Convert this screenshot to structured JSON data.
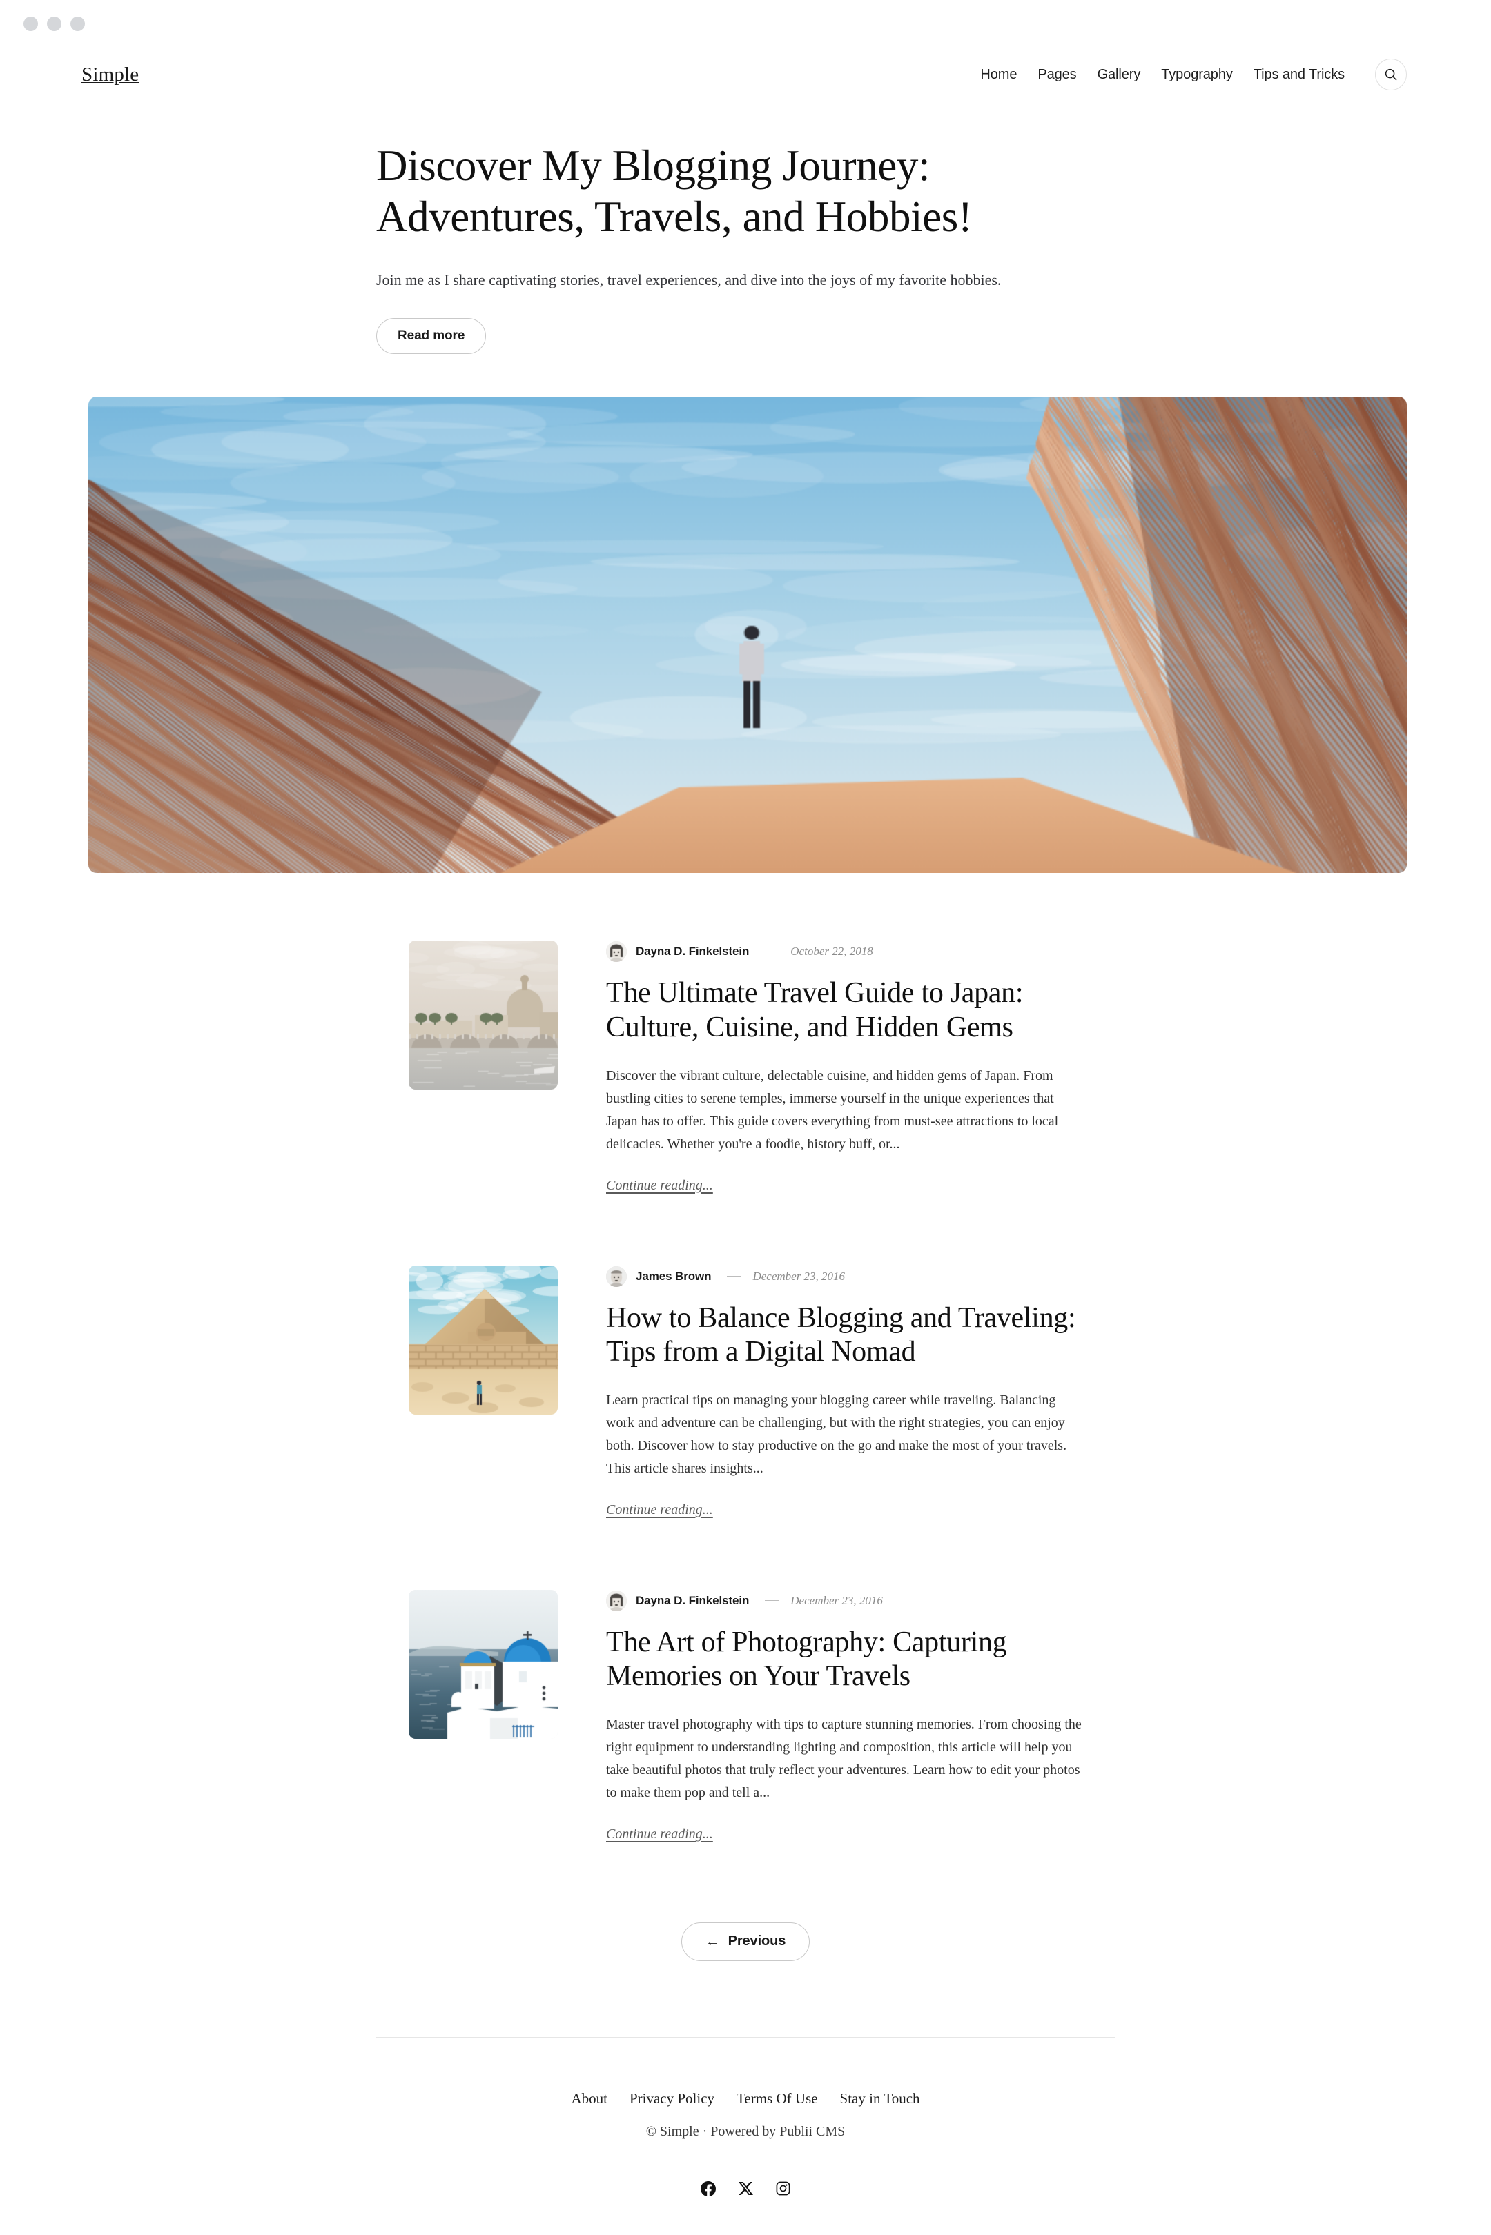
{
  "window": {
    "dots": [
      "window-dot-1",
      "window-dot-2",
      "window-dot-3"
    ]
  },
  "header": {
    "brand": "Simple",
    "nav": [
      {
        "label": "Home"
      },
      {
        "label": "Pages"
      },
      {
        "label": "Gallery"
      },
      {
        "label": "Typography"
      },
      {
        "label": "Tips and Tricks"
      }
    ],
    "search_icon": "search-icon"
  },
  "hero": {
    "title": "Discover My Blogging Journey: Adventures, Travels, and Hobbies!",
    "subtitle": "Join me as I share captivating stories, travel experiences, and dive into the joys of my favorite hobbies.",
    "cta_label": "Read more",
    "image_alt": "Person standing in a striped red sandstone slot canyon under a blue sky"
  },
  "posts": [
    {
      "author": "Dayna D. Finkelstein",
      "date": "October 22, 2018",
      "title": "The Ultimate Travel Guide to Japan: Culture, Cuisine, and Hidden Gems",
      "excerpt": "Discover the vibrant culture, delectable cuisine, and hidden gems of Japan. From bustling cities to serene temples, immerse yourself in the unique experiences that Japan has to offer. This guide covers everything from must-see attractions to local delicacies. Whether you're a foodie, history buff, or...",
      "continue_label": "Continue reading...",
      "thumb_alt": "Rome skyline with St. Peter's Basilica dome and bridge over the Tiber"
    },
    {
      "author": "James Brown",
      "date": "December 23, 2016",
      "title": "How to Balance Blogging and Traveling: Tips from a Digital Nomad",
      "excerpt": "Learn practical tips on managing your blogging career while traveling. Balancing work and adventure can be challenging, but with the right strategies, you can enjoy both. Discover how to stay productive on the go and make the most of your travels. This article shares insights...",
      "continue_label": "Continue reading...",
      "thumb_alt": "Great Sphinx and pyramid of Giza with a person walking in the sand"
    },
    {
      "author": "Dayna D. Finkelstein",
      "date": "December 23, 2016",
      "title": "The Art of Photography: Capturing Memories on Your Travels",
      "excerpt": "Master travel photography with tips to capture stunning memories. From choosing the right equipment to understanding lighting and composition, this article will help you take beautiful photos that truly reflect your adventures. Learn how to edit your photos to make them pop and tell a...",
      "continue_label": "Continue reading...",
      "thumb_alt": "Santorini blue-domed church and bell tower above the Aegean sea"
    }
  ],
  "pagination": {
    "previous_label": "Previous",
    "previous_arrow": "←"
  },
  "footer": {
    "links": [
      {
        "label": "About"
      },
      {
        "label": "Privacy Policy"
      },
      {
        "label": "Terms Of Use"
      },
      {
        "label": "Stay in Touch"
      }
    ],
    "copyright": "© Simple · Powered by Publii CMS",
    "social": [
      {
        "name": "facebook-icon"
      },
      {
        "name": "x-twitter-icon"
      },
      {
        "name": "instagram-icon"
      }
    ]
  },
  "colors": {
    "text": "#101010",
    "muted": "#8b8b8b",
    "border": "#e1e1e1",
    "rule": "#e6e6e6",
    "chrome_dot": "#d5d7da"
  }
}
